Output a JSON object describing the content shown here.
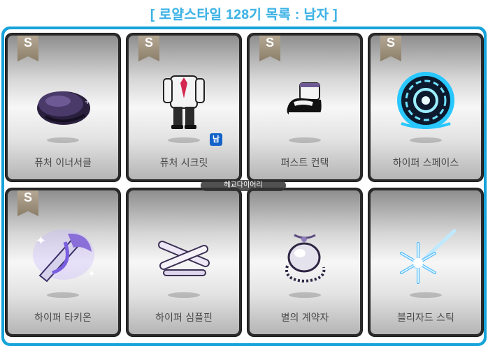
{
  "title": "[ 로얄스타일 128기 목록 : 남자 ]",
  "badge_letter": "S",
  "watermark": "헤교다이어리",
  "colors": {
    "frame": "#16a3d9",
    "title": "#3fb3e6",
    "gender_badge": "#1463c9"
  },
  "items": [
    {
      "name": "퓨처 이너서클",
      "icon": "purple-beret-hat-icon",
      "has_badge": true
    },
    {
      "name": "퓨처 시크릿",
      "icon": "white-suit-outfit-icon",
      "has_badge": true,
      "gender_tag": "남"
    },
    {
      "name": "퍼스트 컨택",
      "icon": "black-white-shoes-icon",
      "has_badge": true
    },
    {
      "name": "하이퍼 스페이스",
      "icon": "blue-portal-ring-icon",
      "has_badge": true
    },
    {
      "name": "하이퍼 타키온",
      "icon": "purple-winged-sword-icon",
      "has_badge": true
    },
    {
      "name": "하이퍼 심플핀",
      "icon": "crossed-white-pins-icon",
      "has_badge": false
    },
    {
      "name": "별의 계약자",
      "icon": "silver-stone-necklace-icon",
      "has_badge": false
    },
    {
      "name": "블리자드 스틱",
      "icon": "ice-snowflake-wand-icon",
      "has_badge": false
    }
  ]
}
